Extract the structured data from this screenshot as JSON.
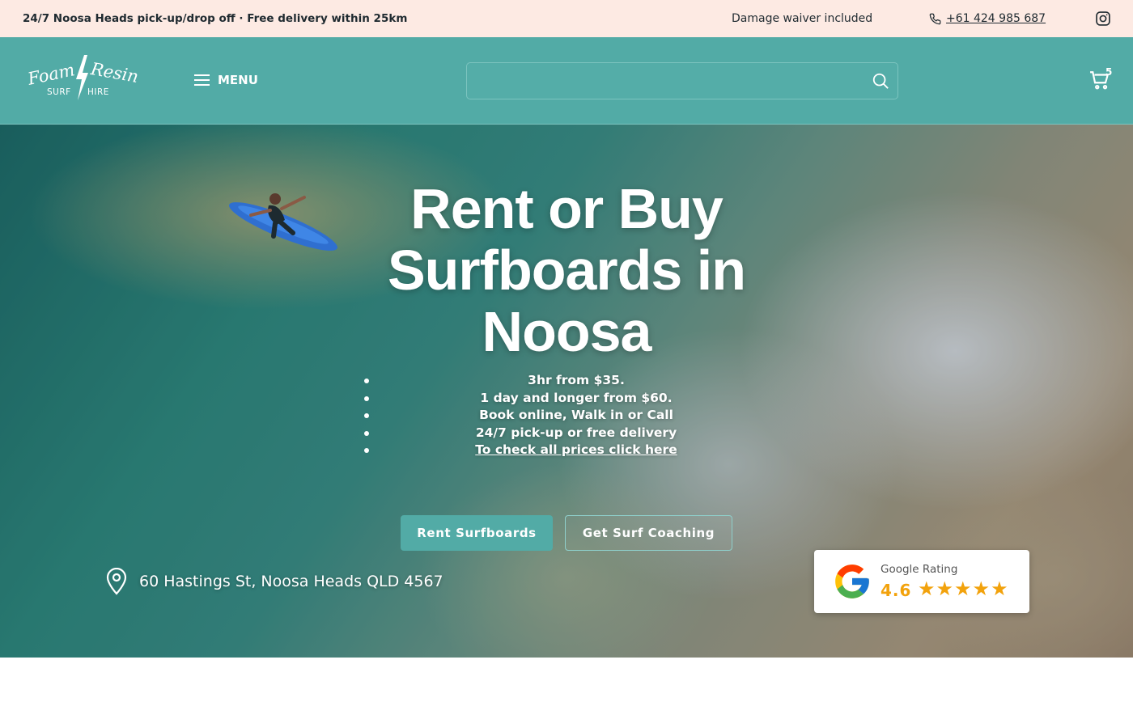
{
  "topbar": {
    "promo": "24/7 Noosa Heads pick-up/drop off · Free delivery within 25km",
    "waiver": "Damage waiver included",
    "phone": "+61 424 985 687",
    "instagram_icon": "instagram-icon"
  },
  "header": {
    "logo": {
      "word1": "Foam",
      "word2": "Resin",
      "sub1": "SURF",
      "sub2": "HIRE"
    },
    "menu_label": "MENU",
    "search_placeholder": "",
    "cart_count": "5"
  },
  "hero": {
    "title": "Rent or Buy Surfboards in Noosa",
    "bullets": [
      "3hr from $35.",
      "1 day and longer from $60.",
      "Book online, Walk in or Call",
      "24/7 pick-up or free delivery"
    ],
    "prices_link": "To check all prices click here",
    "primary_button": "Rent Surfboards",
    "secondary_button": "Get Surf Coaching",
    "address": "60 Hastings St, Noosa Heads QLD 4567"
  },
  "rating": {
    "label": "Google Rating",
    "score": "4.6",
    "stars": 5
  },
  "colors": {
    "accent": "#52aba6",
    "topbar_bg": "#fdeae3",
    "star": "#f2a20c"
  }
}
